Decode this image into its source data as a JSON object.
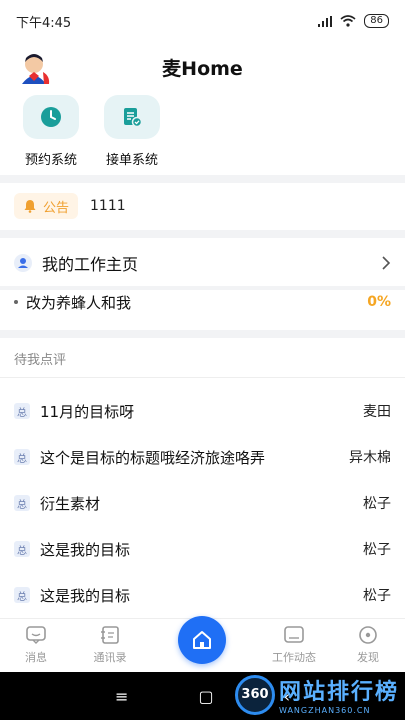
{
  "status_bar": {
    "time": "下午4:45",
    "battery": "86"
  },
  "header": {
    "title": "麦Home"
  },
  "quick_apps": [
    {
      "label": "预约系统",
      "icon": "clock-icon"
    },
    {
      "label": "接单系统",
      "icon": "order-icon"
    }
  ],
  "notice": {
    "badge": "公告",
    "text": "1111"
  },
  "workhome": {
    "label": "我的工作主页"
  },
  "goal": {
    "label": "改为养蜂人和我",
    "percent": "0%"
  },
  "review": {
    "header": "待我点评",
    "tag": "总",
    "items": [
      {
        "title": "11月的目标呀",
        "person": "麦田"
      },
      {
        "title": "这个是目标的标题哦经济旅途咯弄",
        "person": "异木棉"
      },
      {
        "title": "衍生素材",
        "person": "松子"
      },
      {
        "title": "这是我的目标",
        "person": "松子"
      },
      {
        "title": "这是我的目标",
        "person": "松子"
      }
    ]
  },
  "tabbar": {
    "tabs": [
      {
        "label": "消息",
        "icon": "message-icon"
      },
      {
        "label": "通讯录",
        "icon": "contacts-icon"
      },
      {
        "label": "工作动态",
        "icon": "work-feed-icon"
      },
      {
        "label": "发现",
        "icon": "discover-icon"
      }
    ]
  },
  "nav": {
    "menu": "≡",
    "home": "▢",
    "back": "‹"
  },
  "watermark": {
    "logo": "360",
    "main": "网站排行榜",
    "sub": "WANGZHAN360.CN"
  },
  "colors": {
    "accent": "#1f6ff5",
    "notice": "#f0a030",
    "percent": "#f5a623",
    "tile": "#e6f3f5"
  }
}
